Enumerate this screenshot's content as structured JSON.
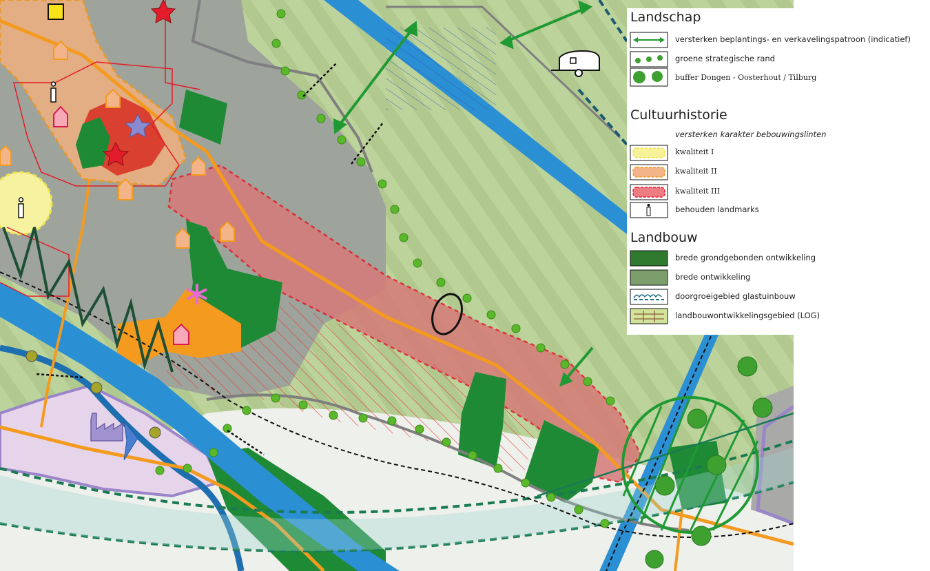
{
  "legend": {
    "sections": [
      {
        "title": "Landschap",
        "items": [
          {
            "label": "versterken beplantings- en verkavelingspatroon (indicatief)",
            "icon": "double-arrow-icon"
          },
          {
            "label": "groene strategische rand",
            "icon": "green-dots-icon"
          },
          {
            "label": "buffer Dongen - Oosterhout / Tilburg",
            "icon": "green-trees-icon"
          }
        ]
      },
      {
        "title": "Cultuurhistorie",
        "subtitle": "versterken karakter bebouwingslinten",
        "items": [
          {
            "label": "kwaliteit I",
            "icon": "yellow-swatch-icon",
            "color": "#f7f29a"
          },
          {
            "label": "kwaliteit II",
            "icon": "orange-swatch-icon",
            "color": "#f4b48a"
          },
          {
            "label": "kwaliteit III",
            "icon": "red-swatch-icon",
            "color": "#ee7c83"
          },
          {
            "label": "behouden landmarks",
            "icon": "landmark-icon"
          }
        ]
      },
      {
        "title": "Landbouw",
        "items": [
          {
            "label": "brede grondgebonden ontwikkeling",
            "icon": "dark-green-swatch-icon",
            "color": "#2f7a2f"
          },
          {
            "label": "brede ontwikkeling",
            "icon": "grey-green-swatch-icon",
            "color": "#7c9d6c"
          },
          {
            "label": "doorgroeigebied glastuinbouw",
            "icon": "greenhouse-icon"
          },
          {
            "label": "landbouwontwikkelingsgebied (LOG)",
            "icon": "log-icon",
            "color": "#d4e39a"
          }
        ]
      }
    ]
  },
  "map": {
    "colors": {
      "agri_field": "#b7cf97",
      "urban_grey": "#a5a8a4",
      "canal_blue": "#2b8fd4",
      "road_orange": "#f39a1f",
      "lint_red": "#d67a78",
      "dark_green": "#1f8a36",
      "industry_lilac": "#e6d5ea"
    }
  }
}
